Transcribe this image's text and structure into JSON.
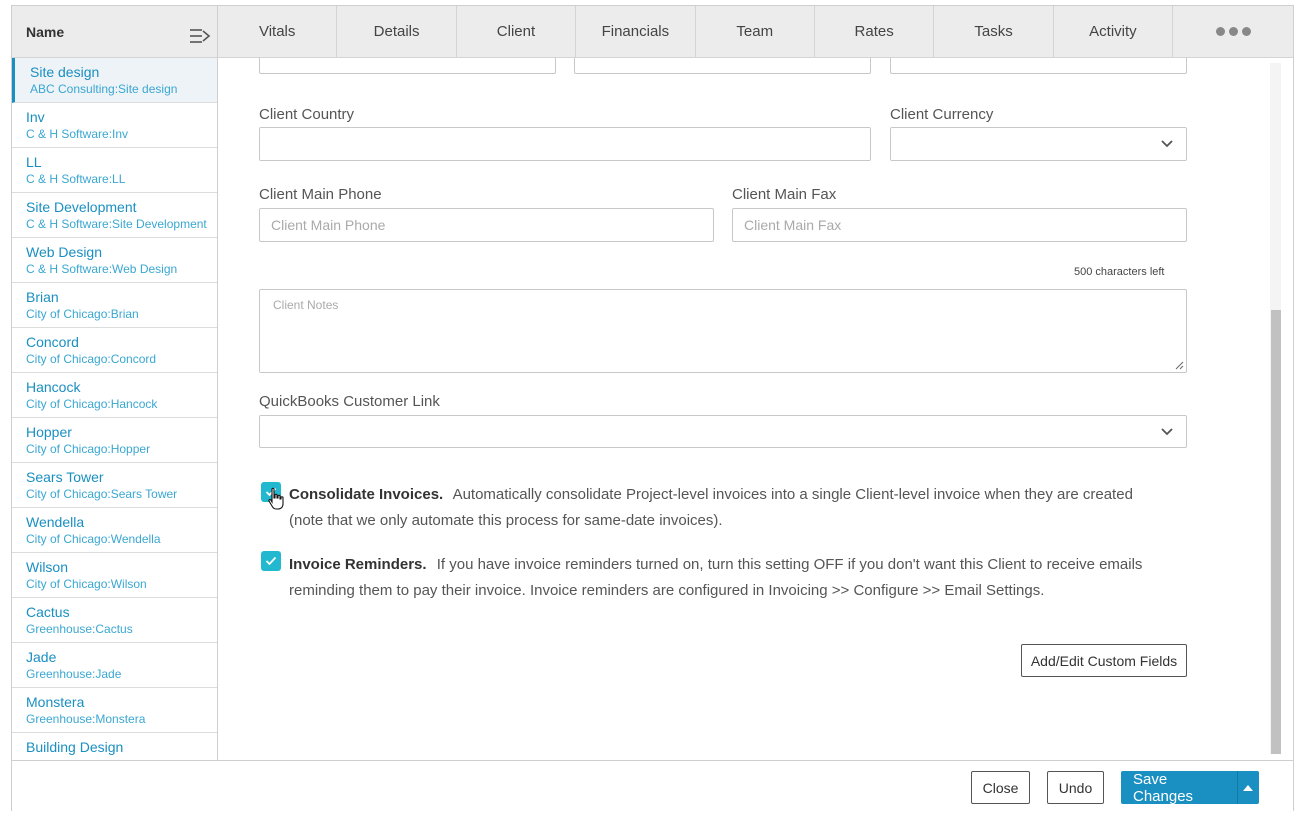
{
  "sidebar": {
    "header": "Name",
    "items": [
      {
        "name": "Site design",
        "sub": "ABC Consulting:Site design",
        "active": true
      },
      {
        "name": "Inv",
        "sub": "C & H Software:Inv"
      },
      {
        "name": "LL",
        "sub": "C & H Software:LL"
      },
      {
        "name": "Site Development",
        "sub": "C & H Software:Site Development"
      },
      {
        "name": "Web Design",
        "sub": "C & H Software:Web Design"
      },
      {
        "name": "Brian",
        "sub": "City of Chicago:Brian"
      },
      {
        "name": "Concord",
        "sub": "City of Chicago:Concord"
      },
      {
        "name": "Hancock",
        "sub": "City of Chicago:Hancock"
      },
      {
        "name": "Hopper",
        "sub": "City of Chicago:Hopper"
      },
      {
        "name": "Sears Tower",
        "sub": "City of Chicago:Sears Tower"
      },
      {
        "name": "Wendella",
        "sub": "City of Chicago:Wendella"
      },
      {
        "name": "Wilson",
        "sub": "City of Chicago:Wilson"
      },
      {
        "name": "Cactus",
        "sub": "Greenhouse:Cactus"
      },
      {
        "name": "Jade",
        "sub": "Greenhouse:Jade"
      },
      {
        "name": "Monstera",
        "sub": "Greenhouse:Monstera"
      },
      {
        "name": "Building Design",
        "sub": ""
      }
    ]
  },
  "tabs": [
    "Vitals",
    "Details",
    "Client",
    "Financials",
    "Team",
    "Rates",
    "Tasks",
    "Activity"
  ],
  "form": {
    "client_country_label": "Client Country",
    "client_country_value": "",
    "client_currency_label": "Client Currency",
    "client_main_phone_label": "Client Main Phone",
    "client_main_phone_placeholder": "Client Main Phone",
    "client_main_fax_label": "Client Main Fax",
    "client_main_fax_placeholder": "Client Main Fax",
    "chars_left": "500 characters left",
    "client_notes_placeholder": "Client Notes",
    "quickbooks_label": "QuickBooks Customer Link",
    "consolidate_title": "Consolidate Invoices.",
    "consolidate_text": "Automatically consolidate Project-level invoices into a single Client-level invoice when they are created (note that we only automate this process for same-date invoices).",
    "consolidate_checked": true,
    "reminders_title": "Invoice Reminders.",
    "reminders_text": "If you have invoice reminders turned on, turn this setting OFF if you don't want this Client to receive emails reminding them to pay their invoice. Invoice reminders are configured in Invoicing >> Configure >> Email Settings.",
    "reminders_checked": true,
    "custom_fields_button": "Add/Edit Custom Fields"
  },
  "footer": {
    "close_label": "Close",
    "undo_label": "Undo",
    "save_label": "Save Changes"
  },
  "colors": {
    "accent": "#1a8fc2",
    "checkbox": "#22b8cf"
  }
}
